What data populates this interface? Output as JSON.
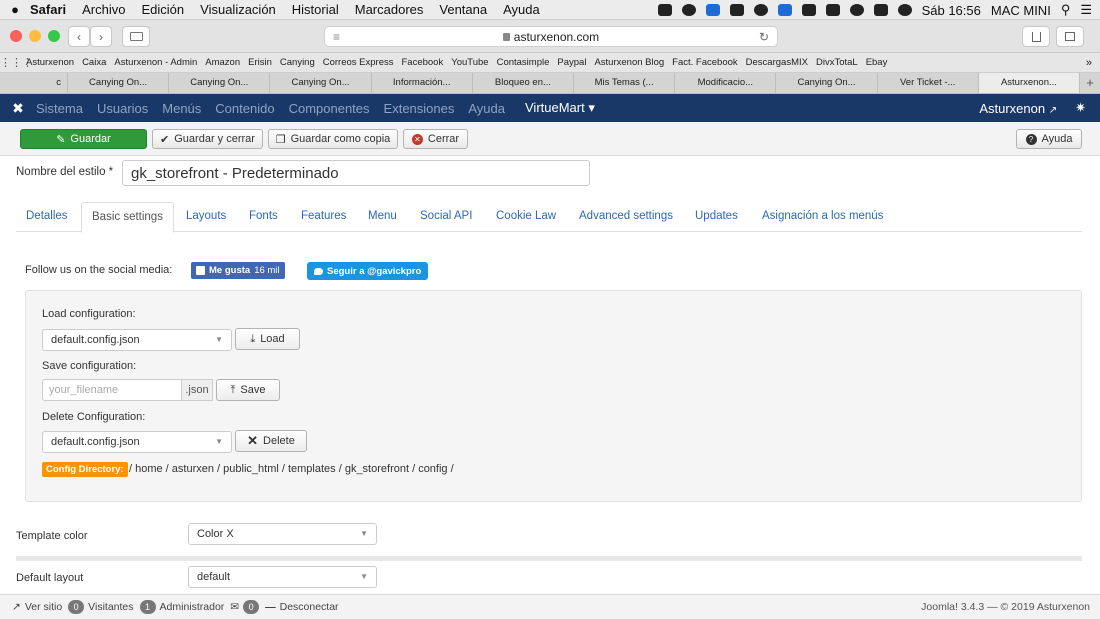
{
  "macbar": {
    "apple": "",
    "app": "Safari",
    "menus": [
      "Archivo",
      "Edición",
      "Visualización",
      "Historial",
      "Marcadores",
      "Ventana",
      "Ayuda"
    ],
    "clock": "Sáb 16:56",
    "device": "MAC MINI"
  },
  "toolbar": {
    "url": "asturxenon.com",
    "back": "‹",
    "forward": "›",
    "sidebar_icon": "sidebar-icon",
    "reader_icon": "≡",
    "reload_icon": "↻",
    "share_icon": "share-icon",
    "tabs_icon": "tabs-icon"
  },
  "bookmarks": [
    "Asturxenon",
    "Caixa",
    "Asturxenon - Admin",
    "Amazon",
    "Erisin",
    "Canying",
    "Correos Express",
    "Facebook",
    "YouTube",
    "Contasimple",
    "Paypal",
    "Asturxenon Blog",
    "Fact. Facebook",
    "DescargasMIX",
    "DivxTotaL",
    "Ebay"
  ],
  "tabs": [
    "c",
    "Canying On...",
    "Canying On...",
    "Canying On...",
    "Información...",
    "Bloqueo en...",
    "Mis Temas (...",
    "Modificacio...",
    "Canying On...",
    "Ver Ticket -...",
    "Asturxenon..."
  ],
  "tabs_active_index": 10,
  "joomla_nav": {
    "items": [
      "Sistema",
      "Usuarios",
      "Menús",
      "Contenido",
      "Componentes",
      "Extensiones",
      "Ayuda"
    ],
    "virtuemart": "VirtueMart ▾",
    "site": "Asturxenon",
    "gear": "✷"
  },
  "actions": {
    "save": "Guardar",
    "save_close": "Guardar y cerrar",
    "save_copy": "Guardar como copia",
    "close": "Cerrar",
    "help": "Ayuda"
  },
  "form": {
    "style_name_label": "Nombre del estilo *",
    "style_name_value": "gk_storefront - Predeterminado"
  },
  "form_tabs": [
    "Detalles",
    "Basic settings",
    "Layouts",
    "Fonts",
    "Features",
    "Menu",
    "Social API",
    "Cookie Law",
    "Advanced settings",
    "Updates",
    "Asignación a los menús"
  ],
  "form_tabs_active": 1,
  "social": {
    "follow_text": "Follow us on the social media:",
    "fb_label": "Me gusta",
    "fb_count": "16 mil",
    "twitter_label": "Seguir a @gavickpro"
  },
  "config": {
    "load_label": "Load configuration:",
    "load_value": "default.config.json",
    "load_button": "Load",
    "save_label": "Save configuration:",
    "save_placeholder": "your_filename",
    "save_addon": ".json",
    "save_button": "Save",
    "delete_label": "Delete Configuration:",
    "delete_value": "default.config.json",
    "delete_button": "Delete",
    "dir_badge": "Config Directory:",
    "dir_path": "/ home / asturxen / public_html / templates / gk_storefront / config /"
  },
  "settings": {
    "template_color_label": "Template color",
    "template_color_value": "Color X",
    "default_layout_label": "Default layout",
    "default_layout_value": "default"
  },
  "status": {
    "view_site": "Ver sitio",
    "visitors_count": "0",
    "visitors_label": "Visitantes",
    "admin_count": "1",
    "admin_label": "Administrador",
    "mail_count": "0",
    "logout": "Desconectar",
    "version": "Joomla! 3.4.3 — © 2019 Asturxenon"
  },
  "colors": {
    "joomla_nav_bg": "#1a3867",
    "save_green": "#2f9a39",
    "link_blue": "#2a69b8",
    "badge_orange": "#f89406",
    "facebook_blue": "#4267b2",
    "twitter_blue": "#1b95e0"
  }
}
